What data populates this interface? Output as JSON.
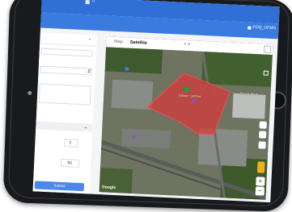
{
  "header": {
    "brand_label": "0",
    "user_label": "POQ_OFMG"
  },
  "form": {
    "number_1_value": "2",
    "number_2_value": "50",
    "submit_label": "Submit"
  },
  "map": {
    "map_tab_label": "Map",
    "satellite_tab_label": "Satellite",
    "map_label": "Map",
    "selected_view": "Satellite",
    "google_label": "Google",
    "zoom_in_symbol": "+",
    "zoom_out_symbol": "−",
    "polygon_fill": "#d9383a",
    "marker_color": "#1e9e3c",
    "place_labels": [
      "Stop & Shop",
      "Edison Lumber"
    ]
  },
  "colors": {
    "accent": "#3a7be0",
    "submit": "#4a88ea"
  }
}
